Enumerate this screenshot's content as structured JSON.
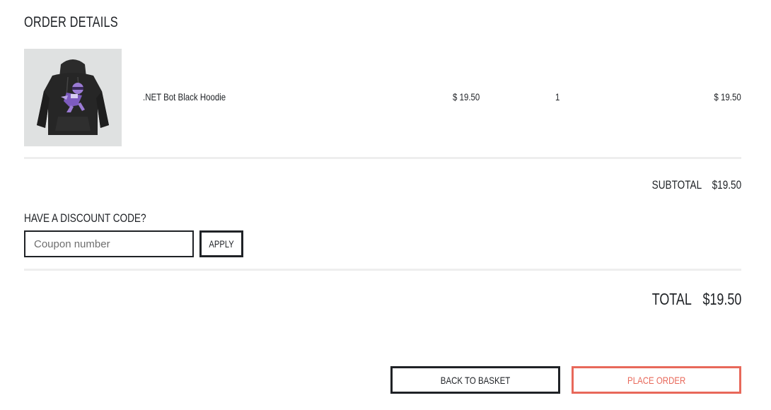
{
  "page": {
    "title": "ORDER DETAILS"
  },
  "order_item": {
    "image_alt": ".NET Bot Black Hoodie",
    "name": ".NET Bot Black Hoodie",
    "unit_price": "$ 19.50",
    "quantity": "1",
    "line_total": "$ 19.50"
  },
  "summary": {
    "subtotal_label": "SUBTOTAL",
    "subtotal_value": "$19.50",
    "total_label": "TOTAL",
    "total_value": "$19.50"
  },
  "discount": {
    "label": "HAVE A DISCOUNT CODE?",
    "placeholder": "Coupon number",
    "value": "",
    "apply_label": "APPLY"
  },
  "actions": {
    "back_label": "BACK TO BASKET",
    "place_label": "PLACE ORDER"
  },
  "colors": {
    "text": "#1f2226",
    "accent": "#e8685a",
    "divider": "#eeeeee",
    "image_background": "#dfe1e1"
  }
}
